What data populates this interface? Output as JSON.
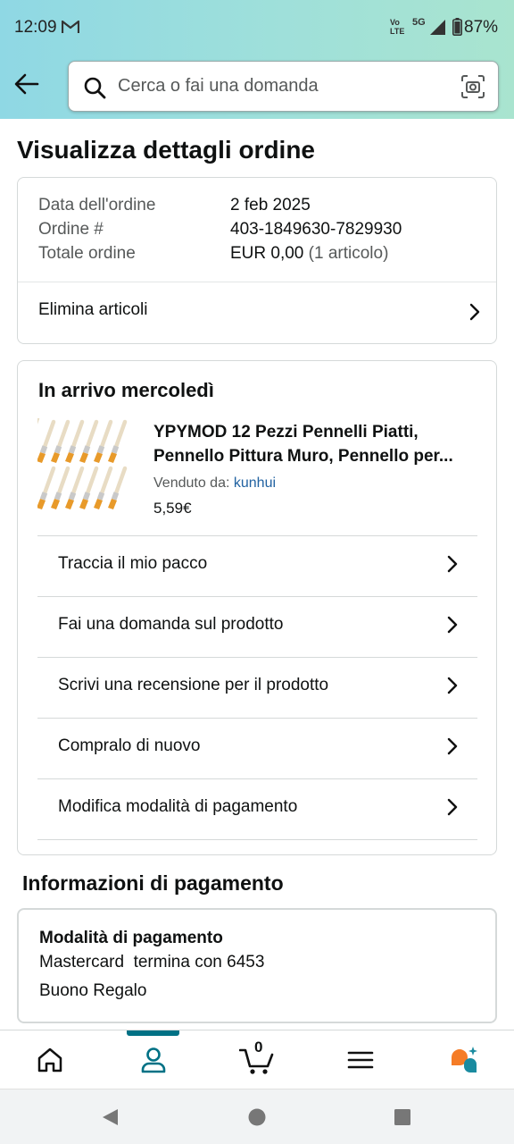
{
  "status_bar": {
    "time": "12:09",
    "network_line1": "Vo",
    "network_line2": "LTE",
    "network_5g": "5G",
    "battery": "87%"
  },
  "search": {
    "placeholder": "Cerca o fai una domanda"
  },
  "page_title": "Visualizza dettagli ordine",
  "order_info": {
    "date_label": "Data dell'ordine",
    "date_value": "2 feb 2025",
    "number_label": "Ordine #",
    "number_value": "403-1849630-7829930",
    "total_label": "Totale ordine",
    "total_value": "EUR 0,00",
    "total_items": "(1 articolo)",
    "delete_items": "Elimina articoli"
  },
  "shipment": {
    "heading": "In arrivo mercoledì",
    "product_title_line1": "YPYMOD 12 Pezzi Pennelli Piatti,",
    "product_title_line2": "Pennello Pittura Muro, Pennello per...",
    "seller_label": "Venduto da:",
    "seller_name": "kunhui",
    "price": "5,59€",
    "actions": [
      {
        "label": "Traccia il mio pacco"
      },
      {
        "label": "Fai una domanda sul prodotto"
      },
      {
        "label": "Scrivi una recensione per il prodotto"
      },
      {
        "label": "Compralo di nuovo"
      },
      {
        "label": "Modifica modalità di pagamento"
      }
    ]
  },
  "payment": {
    "section_title": "Informazioni di pagamento",
    "method_heading": "Modalità di pagamento",
    "card_line": "Mastercard  termina con 6453",
    "gift_line": "Buono Regalo"
  },
  "bottom_nav": {
    "cart_count": "0",
    "active_tab": "account"
  },
  "colors": {
    "accent": "#007185",
    "link": "#2162a1",
    "header_gradient_start": "#8fd8e4",
    "header_gradient_end": "#a9e4cf"
  }
}
